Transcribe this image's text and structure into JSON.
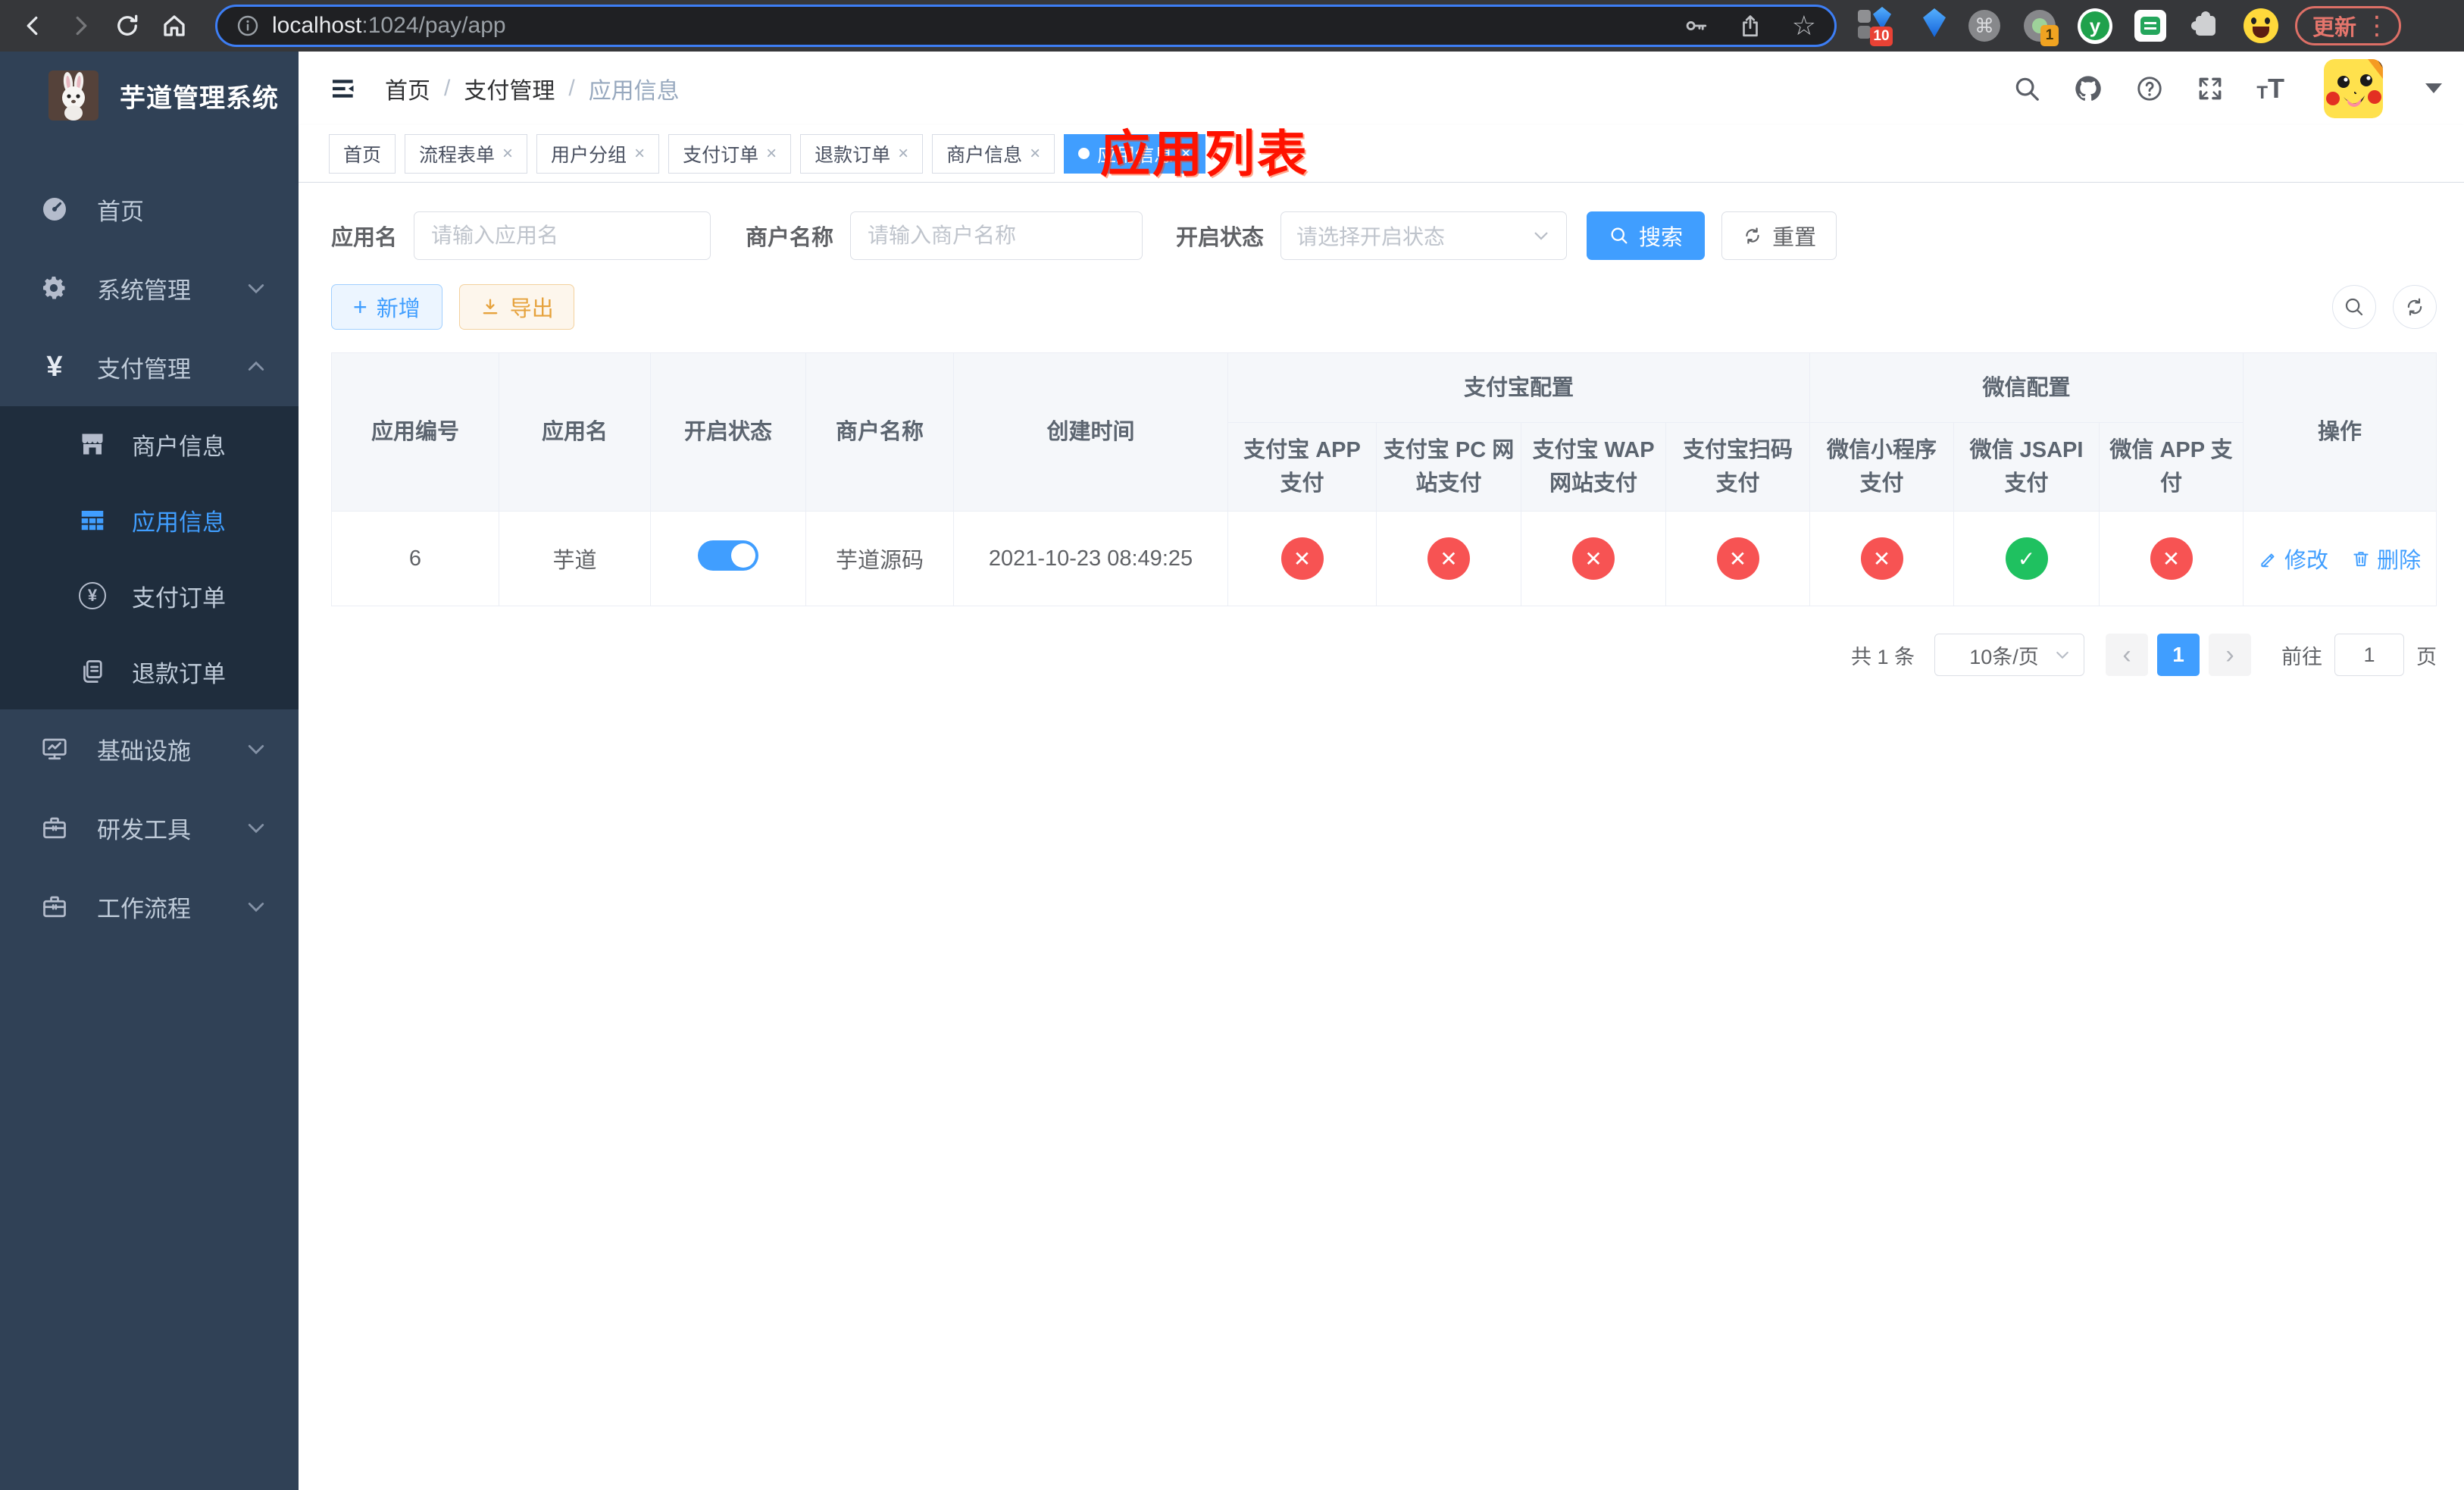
{
  "browser": {
    "url_host": "localhost",
    "url_path": ":1024/pay/app",
    "update_label": "更新",
    "badge_ten": "10",
    "badge_one": "1",
    "ext_y_label": "y"
  },
  "icons": {
    "command": "⌘",
    "star": "☆",
    "more_vert": "⋮",
    "yen": "¥",
    "close": "×",
    "prev": "‹",
    "next": "›",
    "plus": "+",
    "t_small": "T",
    "t_large": "T"
  },
  "sidebar": {
    "logo_title": "芋道管理系统",
    "home": "首页",
    "system": "系统管理",
    "payment": "支付管理",
    "merchant": "商户信息",
    "app_info": "应用信息",
    "pay_order": "支付订单",
    "refund_order": "退款订单",
    "infra": "基础设施",
    "devtools": "研发工具",
    "workflow": "工作流程"
  },
  "breadcrumb": {
    "home": "首页",
    "section": "支付管理",
    "current": "应用信息",
    "separator": "/"
  },
  "overlay_title": "应用列表",
  "tabs": [
    {
      "label": "首页",
      "closable": false,
      "active": false
    },
    {
      "label": "流程表单",
      "closable": true,
      "active": false
    },
    {
      "label": "用户分组",
      "closable": true,
      "active": false
    },
    {
      "label": "支付订单",
      "closable": true,
      "active": false
    },
    {
      "label": "退款订单",
      "closable": true,
      "active": false
    },
    {
      "label": "商户信息",
      "closable": true,
      "active": false
    },
    {
      "label": "应用信息",
      "closable": true,
      "active": true
    }
  ],
  "filters": {
    "app_name": {
      "label": "应用名",
      "placeholder": "请输入应用名",
      "value": ""
    },
    "merchant": {
      "label": "商户名称",
      "placeholder": "请输入商户名称",
      "value": ""
    },
    "status": {
      "label": "开启状态",
      "placeholder": "请选择开启状态"
    },
    "search_label": "搜索",
    "reset_label": "重置"
  },
  "toolbar": {
    "add_label": "新增",
    "export_label": "导出"
  },
  "table": {
    "groups": {
      "alipay": "支付宝配置",
      "wechat": "微信配置"
    },
    "columns": [
      "应用编号",
      "应用名",
      "开启状态",
      "商户名称",
      "创建时间",
      "支付宝 APP 支付",
      "支付宝 PC 网站支付",
      "支付宝 WAP 网站支付",
      "支付宝扫码支付",
      "微信小程序支付",
      "微信 JSAPI 支付",
      "微信 APP 支付",
      "操作"
    ],
    "status_glyphs": {
      "cross": "✕",
      "check": "✓"
    },
    "row": {
      "id": "6",
      "name": "芋道",
      "enabled": true,
      "merchant": "芋道源码",
      "created": "2021-10-23 08:49:25",
      "channel_status": [
        "cross",
        "cross",
        "cross",
        "cross",
        "cross",
        "check",
        "cross"
      ],
      "edit_label": "修改",
      "delete_label": "删除"
    }
  },
  "pagination": {
    "total": "共 1 条",
    "page_size": "10条/页",
    "page": "1",
    "goto_label": "前往",
    "goto_value": "1",
    "unit_label": "页"
  }
}
